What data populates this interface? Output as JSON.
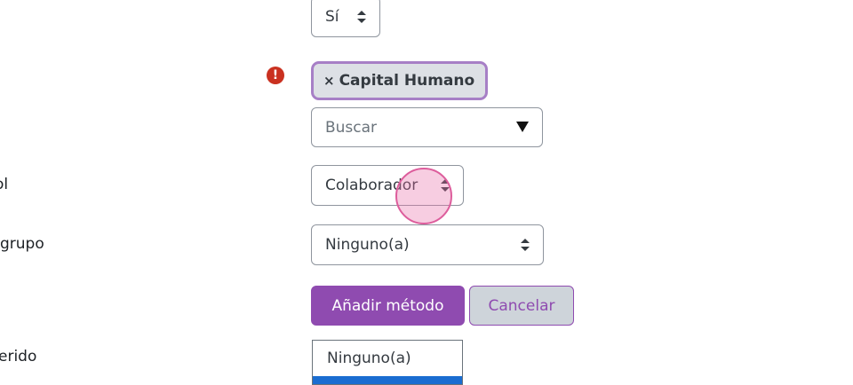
{
  "labels": {
    "role": "ol",
    "group": "grupo",
    "required": "erido"
  },
  "select_top": {
    "value": "Sí"
  },
  "error_icon": "!",
  "tag": {
    "remove": "×",
    "label": "Capital Humano"
  },
  "search": {
    "placeholder": "Buscar"
  },
  "role_select": {
    "value": "Colaborador"
  },
  "group_select": {
    "value": "Ninguno(a)"
  },
  "buttons": {
    "add": "Añadir método",
    "cancel": "Cancelar"
  },
  "dropdown": {
    "options": [
      "Ninguno(a)"
    ]
  },
  "colors": {
    "primary": "#8f4bb0",
    "danger": "#ca3120",
    "highlight": "#1a6dd1"
  }
}
